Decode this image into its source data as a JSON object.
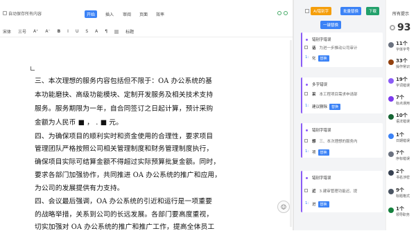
{
  "header": {
    "autosave": "自动保存所有内容",
    "tabs": [
      "开始",
      "插入",
      "审阅",
      "页面",
      "效率"
    ]
  },
  "ribbon": {
    "font": "宋体",
    "size": "三号",
    "items": [
      "A⁺",
      "A⁻",
      "B",
      "I",
      "U",
      "S",
      "A",
      "¶",
      "标题"
    ]
  },
  "document": {
    "lines": [
      "三、本次理想的服务内容包括但不限于：OA 办公系统的基",
      "本功能磨抉、高级功能模块、定制开发服务及相关技术支持",
      "服务。服务期限为一年，自合同签订之日起计算，预计采购",
      "金额为人民币   ■  ，  .   ■   元。",
      "四、为确保项目的顺利实时和资金使用的合理性，要求项目",
      "管理团队严格按照公司相关管理制度和财务管理制度执行，",
      "确保项目实际可结算金额不得超过实际预算批复金额。同时，",
      "要求各部门加强协作，共同推进 OA 办公系统的推广和应用，",
      "为公司的发展提供有力支持。",
      "四、会议最后强调，OA 办公系统的引近和运行是一项重要",
      "的战略举措，关系到公司的长远发展。各部门要高度重视，",
      "切实加强对 OA 办公系统的推广和推广工作，提高全体员工"
    ]
  },
  "toolbar_right": {
    "type_filter": "A/错别字",
    "batch_replace": "批量替换",
    "download": "下载",
    "one_click": "一键替换"
  },
  "cards": [
    {
      "category": "错别字错误",
      "orig": "话",
      "context": "为进一步推动公司审计",
      "num": "1:",
      "sugg": "化",
      "btn": "替换"
    },
    {
      "category": "多字错误",
      "orig": "采",
      "context": "本工程项目需求申请部",
      "num": "1:",
      "sugg": "建议删除",
      "btn": "替换"
    },
    {
      "category": "错别字错误",
      "orig": "想",
      "context": "三、本次理想的服务内",
      "num": "1:",
      "sugg": "项",
      "btn": "替换"
    },
    {
      "category": "错别字错误",
      "orig": "近",
      "context": "3.建审管理功能迟、提",
      "num": "1:",
      "sugg": "进",
      "btn": "替换"
    }
  ],
  "stats": {
    "title": "所有提示",
    "score": "93",
    "items": [
      {
        "value": "11个",
        "label": "字体字号",
        "color": "#6b7280"
      },
      {
        "value": "33个",
        "label": "操作常识",
        "color": "#92400e"
      },
      {
        "value": "19个",
        "label": "字词错误",
        "color": "#8b5cf6"
      },
      {
        "value": "7个",
        "label": "标点误用",
        "color": "#7c3aed"
      },
      {
        "value": "10个",
        "label": "语法错误",
        "color": "#166534"
      },
      {
        "value": "1个",
        "label": "日期错误",
        "color": "#3b82f6"
      },
      {
        "value": "7个",
        "label": "序标错误",
        "color": "#6b7280"
      },
      {
        "value": "2个",
        "label": "书名涉密",
        "color": "#374151"
      },
      {
        "value": "9个",
        "label": "标题格式",
        "color": "#4b5563"
      },
      {
        "value": "1个",
        "label": "领导职务",
        "color": "#15803d"
      }
    ]
  }
}
